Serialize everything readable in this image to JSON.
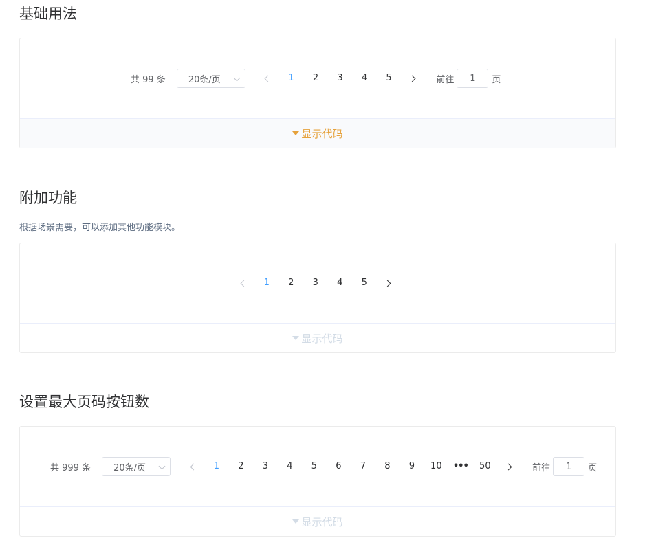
{
  "basic": {
    "title": "基础用法",
    "total": "共 99 条",
    "page_size": "20条/页",
    "pages": [
      "1",
      "2",
      "3",
      "4",
      "5"
    ],
    "active_page": "1",
    "goto_label": "前往",
    "goto_value": "1",
    "page_unit": "页",
    "show_code": "显示代码"
  },
  "extra": {
    "title": "附加功能",
    "description": "根据场景需要，可以添加其他功能模块。",
    "pages": [
      "1",
      "2",
      "3",
      "4",
      "5"
    ],
    "active_page": "1",
    "show_code": "显示代码"
  },
  "max_pager": {
    "title": "设置最大页码按钮数",
    "total": "共 999 条",
    "page_size": "20条/页",
    "pages": [
      "1",
      "2",
      "3",
      "4",
      "5",
      "6",
      "7",
      "8",
      "9",
      "10",
      "•••",
      "50"
    ],
    "active_page": "1",
    "goto_label": "前往",
    "goto_value": "1",
    "page_unit": "页",
    "show_code": "显示代码"
  },
  "colors": {
    "primary": "#409eff",
    "show_code_hover": "#e6a23c",
    "show_code_idle": "#d3dce6"
  }
}
